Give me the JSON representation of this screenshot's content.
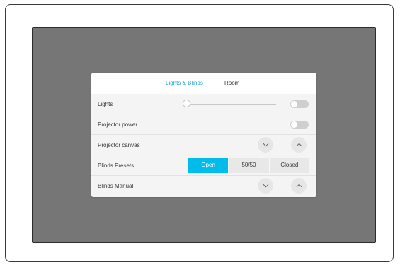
{
  "tabs": [
    {
      "label": "Lights & Blinds",
      "active": true
    },
    {
      "label": "Room",
      "active": false
    }
  ],
  "rows": {
    "lights": {
      "label": "Lights",
      "slider_level": 0,
      "toggle_on": false
    },
    "projector_power": {
      "label": "Projector power",
      "toggle_on": false
    },
    "projector_canvas": {
      "label": "Projector canvas",
      "down_icon": "chevron-down-icon",
      "up_icon": "chevron-up-icon"
    },
    "blinds_presets": {
      "label": "Blinds Presets",
      "options": [
        "Open",
        "50/50",
        "Closed"
      ],
      "selected": "Open"
    },
    "blinds_manual": {
      "label": "Blinds Manual",
      "down_icon": "chevron-down-icon",
      "up_icon": "chevron-up-icon"
    }
  },
  "colors": {
    "accent": "#27a9d7",
    "active_segment": "#00bceb",
    "screen_bg": "#767676"
  }
}
